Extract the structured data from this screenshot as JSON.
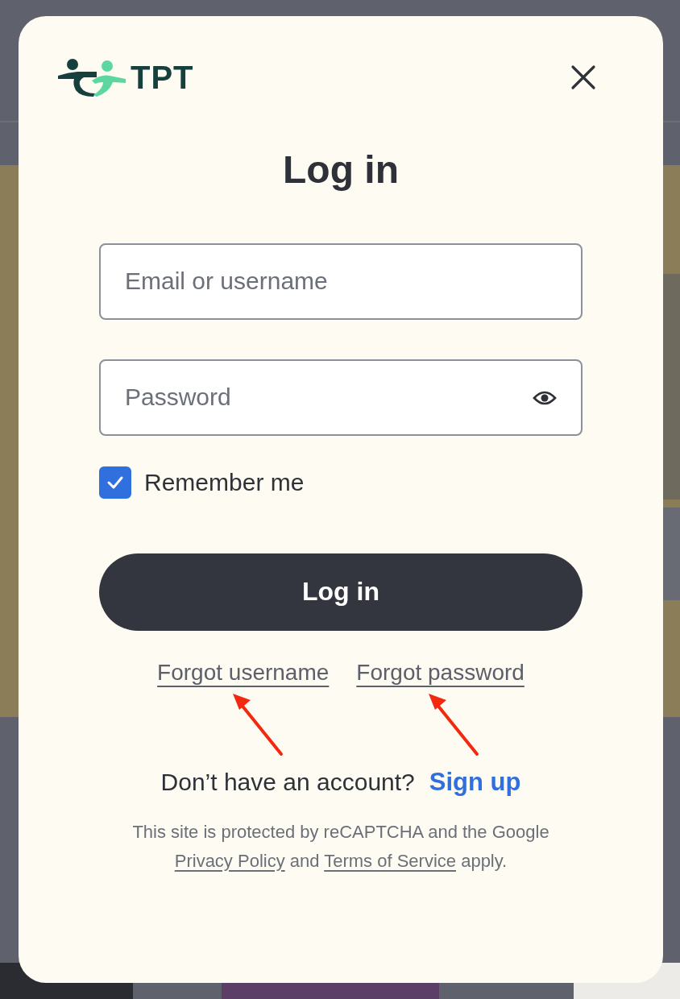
{
  "logo": {
    "text": "TPT"
  },
  "dialog": {
    "title": "Log in"
  },
  "fields": [
    {
      "kind": "text",
      "placeholder": "Email or username"
    },
    {
      "kind": "password",
      "placeholder": "Password"
    }
  ],
  "remember": {
    "label": "Remember me",
    "checked": true
  },
  "submit": {
    "label": "Log in"
  },
  "links": [
    "Forgot username",
    "Forgot password"
  ],
  "signup": {
    "prompt": "Don’t have an account?",
    "link": "Sign up"
  },
  "notice": {
    "before": "This site is protected by reCAPTCHA and the Google",
    "privacy": "Privacy Policy",
    "middle": "and",
    "terms": "Terms of Service",
    "after": "apply."
  }
}
